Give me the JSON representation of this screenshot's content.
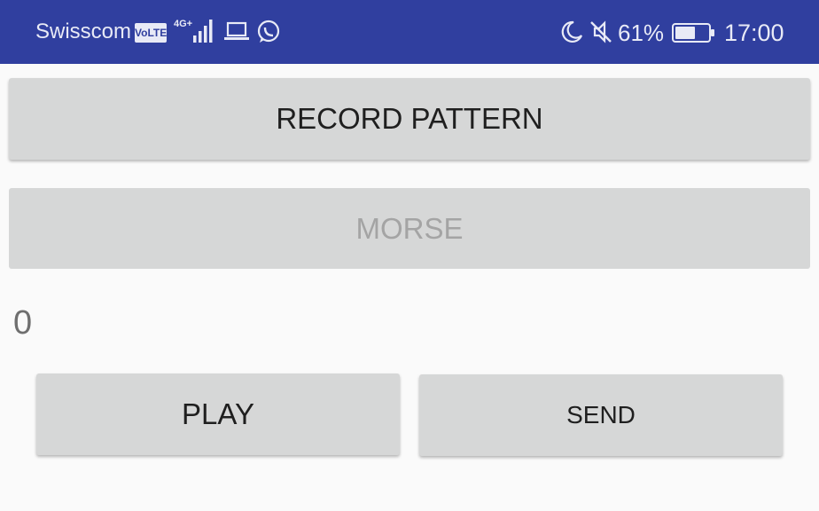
{
  "status_bar": {
    "carrier": "Swisscom",
    "volte": "VoLTE",
    "network": "4G+",
    "battery_percent": "61%",
    "time": "17:00",
    "icons": [
      "signal-icon",
      "laptop-icon",
      "whatsapp-icon",
      "moon-icon",
      "muted-icon",
      "battery-icon"
    ],
    "battery_level": 0.61,
    "bar_color": "#303f9f"
  },
  "buttons": {
    "record_label": "RECORD PATTERN",
    "morse_label": "MORSE",
    "play_label": "PLAY",
    "send_label": "SEND"
  },
  "counter": {
    "value": "0"
  },
  "colors": {
    "background": "#fafafa",
    "button": "#d6d7d7",
    "disabled_text": "#a4a4a4"
  }
}
